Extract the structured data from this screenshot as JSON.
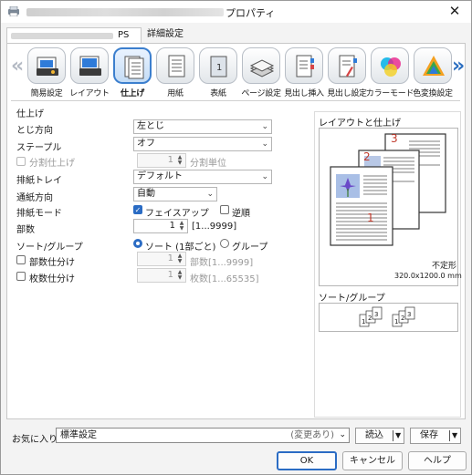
{
  "window": {
    "title": "プロパティ",
    "close_glyph": "✕"
  },
  "tabs": [
    {
      "suffix": "PS"
    },
    {
      "label": "詳細設定"
    }
  ],
  "strip": {
    "left_arrow": "«",
    "right_arrow": "»",
    "items": [
      {
        "label": "簡易設定",
        "icon": "quick-setup-icon"
      },
      {
        "label": "レイアウト",
        "icon": "layout-icon"
      },
      {
        "label": "仕上げ",
        "icon": "finishing-icon"
      },
      {
        "label": "用紙",
        "icon": "paper-icon"
      },
      {
        "label": "表紙",
        "icon": "cover-icon"
      },
      {
        "label": "ページ設定",
        "icon": "page-setup-icon"
      },
      {
        "label": "見出し挿入",
        "icon": "tab-insert-icon"
      },
      {
        "label": "見出し設定",
        "icon": "tab-setting-icon"
      },
      {
        "label": "カラーモード",
        "icon": "color-mode-icon"
      },
      {
        "label": "色変換設定",
        "icon": "color-conversion-icon"
      }
    ]
  },
  "form": {
    "group_title": "仕上げ",
    "binding": {
      "label": "とじ方向",
      "value": "左とじ"
    },
    "staple": {
      "label": "ステープル",
      "value": "オフ"
    },
    "split": {
      "label": "分割仕上げ",
      "value": "1",
      "unit": "分割単位"
    },
    "output_tray": {
      "label": "排紙トレイ",
      "value": "デフォルト"
    },
    "paper_direction": {
      "label": "通紙方向",
      "value": "自動"
    },
    "output_mode": {
      "label": "排紙モード",
      "face_up": "フェイスアップ",
      "reverse": "逆順"
    },
    "copies": {
      "label": "部数",
      "value": "1",
      "range": "[1...9999]"
    },
    "sort": {
      "label": "ソート/グループ",
      "sort": "ソート (1部ごと)",
      "group": "グループ"
    },
    "copy_split": {
      "label": "部数仕分け",
      "value": "1",
      "range": "部数[1...9999]"
    },
    "sheet_split": {
      "label": "枚数仕分け",
      "value": "1",
      "range": "枚数[1...65535]"
    }
  },
  "preview": {
    "title": "レイアウトと仕上げ",
    "page_numbers": [
      "3",
      "2",
      "1"
    ],
    "paper_type": "不定形",
    "paper_size": "320.0x1200.0 mm",
    "sort_title": "ソート/グループ"
  },
  "footer": {
    "favorites_label": "お気に入り",
    "favorites_value": "標準設定",
    "favorites_modified": "(変更あり)",
    "load": "読込",
    "save": "保存",
    "ok": "OK",
    "cancel": "キャンセル",
    "help": "ヘルプ"
  },
  "colors": {
    "accent": "#2b6cc4",
    "page_number": "#c0392b"
  }
}
